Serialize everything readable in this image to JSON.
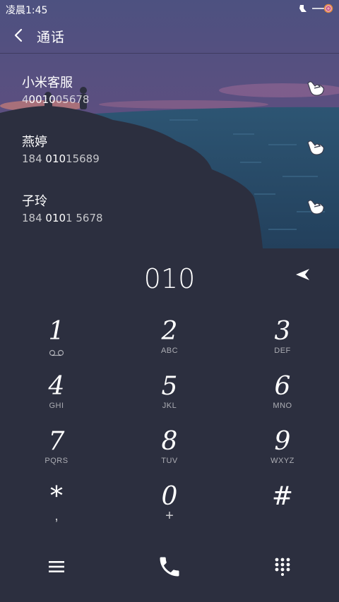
{
  "status_bar": {
    "time": "凌晨1:45",
    "icons": [
      "notification-icon",
      "battery-icon"
    ]
  },
  "app_bar": {
    "title": "通话",
    "back_icon": "back-arrow-icon"
  },
  "contacts": [
    {
      "name": "小米客服",
      "number_pre": "4",
      "number_match": "0010",
      "number_post": "05678",
      "action_icon": "call-hand-icon"
    },
    {
      "name": "燕婷",
      "number_pre": "184 ",
      "number_match": "010",
      "number_post": "15689",
      "action_icon": "call-hand-icon"
    },
    {
      "name": "子玲",
      "number_pre": "184 ",
      "number_match": "010",
      "number_post": "1 5678",
      "action_icon": "call-hand-icon"
    }
  ],
  "dial": {
    "number": "010",
    "backspace_icon": "backspace-icon"
  },
  "keypad": [
    {
      "digit": "1",
      "letters": "ᴏᴏ"
    },
    {
      "digit": "2",
      "letters": "ABC"
    },
    {
      "digit": "3",
      "letters": "DEF"
    },
    {
      "digit": "4",
      "letters": "GHI"
    },
    {
      "digit": "5",
      "letters": "JKL"
    },
    {
      "digit": "6",
      "letters": "MNO"
    },
    {
      "digit": "7",
      "letters": "PQRS"
    },
    {
      "digit": "8",
      "letters": "TUV"
    },
    {
      "digit": "9",
      "letters": "WXYZ"
    },
    {
      "digit": "*",
      "letters": ","
    },
    {
      "digit": "0",
      "letters": "+"
    },
    {
      "digit": "#",
      "letters": ""
    }
  ],
  "bottom_bar": {
    "menu_icon": "menu-icon",
    "call_icon": "phone-icon",
    "keypad_icon": "dialpad-icon"
  },
  "colors": {
    "background": "#2c2f3f",
    "sky_top": "#4a4e7a",
    "sky_glow": "#8a5a86",
    "sea": "#2a4f6c",
    "cliff": "#2a2d3c"
  }
}
